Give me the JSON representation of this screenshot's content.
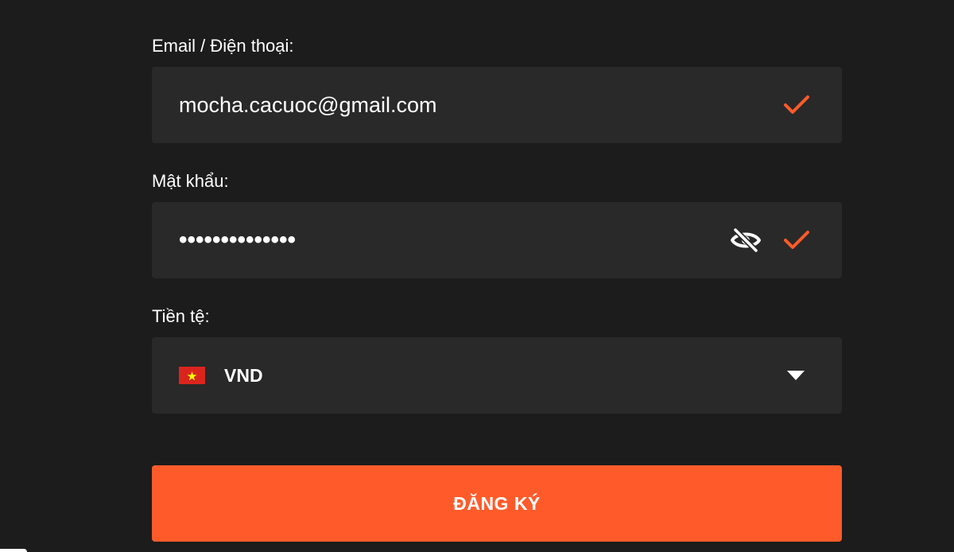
{
  "form": {
    "email": {
      "label": "Email / Điện thoại:",
      "value": "mocha.cacuoc@gmail.com",
      "valid_icon": "check-icon"
    },
    "password": {
      "label": "Mật khẩu:",
      "masked_value": "••••••••••••••",
      "toggle_icon": "eye-slash-icon",
      "valid_icon": "check-icon"
    },
    "currency": {
      "label": "Tiền tệ:",
      "selected": "VND",
      "flag_icon": "vietnam-flag-icon",
      "dropdown_icon": "caret-down-icon"
    },
    "submit_label": "ĐĂNG KÝ"
  },
  "colors": {
    "background": "#1c1c1c",
    "field_background": "#292929",
    "accent": "#ff5b2a",
    "flag_red": "#da251d",
    "flag_star": "#ffff00"
  }
}
